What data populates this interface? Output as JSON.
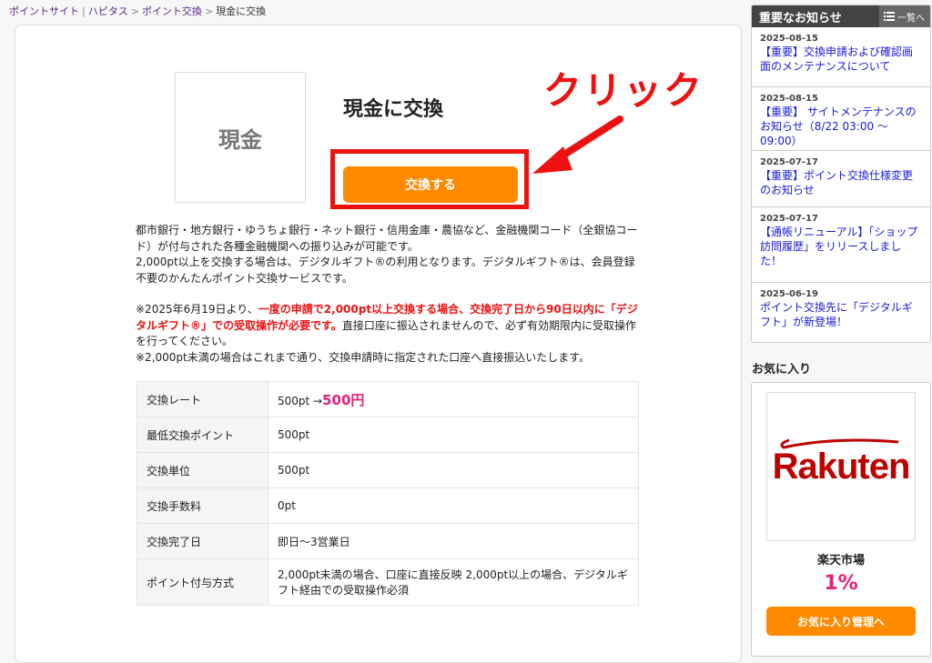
{
  "breadcrumb": {
    "items": [
      "ポイントサイト",
      "ハピタス",
      "ポイント交換"
    ],
    "separator": ">",
    "divider": "|",
    "current": "現金に交換"
  },
  "main": {
    "logo_text": "現金",
    "title": "現金に交換",
    "exchange_button": "交換する",
    "annotation": "クリック",
    "description": {
      "p1": "都市銀行・地方銀行・ゆうちょ銀行・ネット銀行・信用金庫・農協など、金融機関コード（全銀協コード）が付与された各種金融機関への振り込みが可能です。",
      "p2": "2,000pt以上を交換する場合は、デジタルギフト®の利用となります。デジタルギフト®は、会員登録不要のかんたんポイント交換サービスです。",
      "p3_prefix": "※2025年6月19日より、",
      "p3_red": "一度の申請で2,000pt以上交換する場合、交換完了日から90日以内に「デジタルギフト®」での受取操作が必要です。",
      "p3_suffix": "直接口座に振込されませんので、必ず有効期限内に受取操作を行ってください。",
      "p4": "※2,000pt未満の場合はこれまで通り、交換申請時に指定された口座へ直接振込いたします。"
    },
    "table": {
      "rate_label": "交換レート",
      "rate_from": "500pt →",
      "rate_to": "500円",
      "min_label": "最低交換ポイント",
      "min_value": "500pt",
      "unit_label": "交換単位",
      "unit_value": "500pt",
      "fee_label": "交換手数料",
      "fee_value": "0pt",
      "completion_label": "交換完了日",
      "completion_value": "即日〜3営業日",
      "method_label": "ポイント付与方式",
      "method_value": "2,000pt未満の場合、口座に直接反映 2,000pt以上の場合、デジタルギフト経由での受取操作必須"
    }
  },
  "sidebar": {
    "notice_title": "重要なお知らせ",
    "all_label": "一覧へ",
    "notices": [
      {
        "date": "2025-08-15",
        "text": "【重要】交換申請および確認画面のメンテナンスについて"
      },
      {
        "date": "2025-08-15",
        "text": "【重要】 サイトメンテナンスのお知らせ（8/22 03:00 〜 09:00）"
      },
      {
        "date": "2025-07-17",
        "text": "【重要】ポイント交換仕様変更のお知らせ"
      },
      {
        "date": "2025-07-17",
        "text": "【通帳リニューアル】「ショップ訪問履歴」をリリースしました！"
      },
      {
        "date": "2025-06-19",
        "text": "ポイント交換先に「デジタルギフト」が新登場！"
      }
    ],
    "favorites_title": "お気に入り",
    "favorite": {
      "logo_text": "Rakuten",
      "name": "楽天市場",
      "rate": "1%",
      "button": "お気に入り管理へ"
    }
  },
  "colors": {
    "accent_orange": "#ff8a00",
    "annotation_red": "#ee1111",
    "rate_pink": "#e8207a",
    "rakuten_red": "#bf0000",
    "link_blue": "#1a1adb"
  }
}
